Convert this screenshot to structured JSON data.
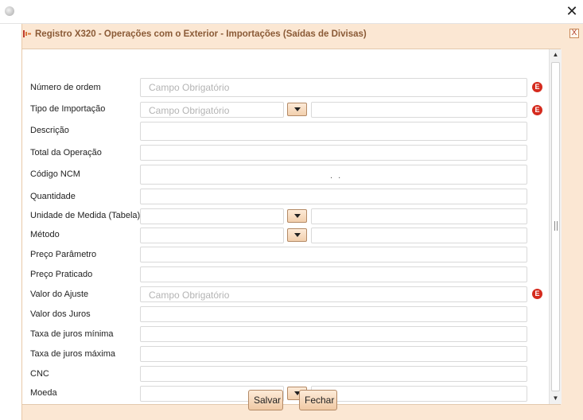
{
  "dialog": {
    "title": "Registro X320 - Operações com o Exterior - Importações (Saídas de Divisas)",
    "close_label": "X"
  },
  "window": {
    "close_glyph": "✕"
  },
  "fields": {
    "numero_ordem": {
      "label": "Número de ordem",
      "placeholder": "Campo Obrigatório",
      "required_badge": "E"
    },
    "tipo_importacao": {
      "label": "Tipo de Importação",
      "placeholder": "Campo Obrigatório",
      "required_badge": "E"
    },
    "descricao": {
      "label": "Descrição"
    },
    "total_operacao": {
      "label": "Total da Operação"
    },
    "codigo_ncm": {
      "label": "Código NCM",
      "mask": ". ."
    },
    "quantidade": {
      "label": "Quantidade"
    },
    "unidade_medida": {
      "label": "Unidade de Medida (Tabela)"
    },
    "metodo": {
      "label": "Método"
    },
    "preco_parametro": {
      "label": "Preço Parâmetro"
    },
    "preco_praticado": {
      "label": "Preço Praticado"
    },
    "valor_ajuste": {
      "label": "Valor do Ajuste",
      "placeholder": "Campo Obrigatório",
      "required_badge": "E"
    },
    "valor_juros": {
      "label": "Valor dos Juros"
    },
    "taxa_juros_minima": {
      "label": "Taxa de juros mínima"
    },
    "taxa_juros_maxima": {
      "label": "Taxa de juros máxima"
    },
    "cnc": {
      "label": "CNC"
    },
    "moeda": {
      "label": "Moeda"
    }
  },
  "buttons": {
    "save": "Salvar",
    "close": "Fechar"
  },
  "icons": {
    "app": "circle-app-icon",
    "header": "bars-icon",
    "required": "error-badge-icon",
    "dropdown": "triangle-down-icon"
  },
  "colors": {
    "accent": "#fbe7d3",
    "title": "#8a5a36",
    "required": "#d52b1e"
  }
}
